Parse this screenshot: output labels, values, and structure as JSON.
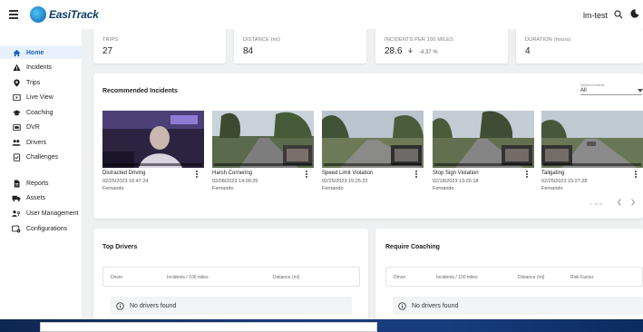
{
  "header": {
    "logo_text": "EasiTrack",
    "username": "lm-test"
  },
  "sidebar": {
    "items": [
      {
        "label": "Home",
        "icon": "home-icon",
        "active": true
      },
      {
        "label": "Incidents",
        "icon": "warning-icon"
      },
      {
        "label": "Trips",
        "icon": "map-pin-icon"
      },
      {
        "label": "Live View",
        "icon": "live-view-icon"
      },
      {
        "label": "Coaching",
        "icon": "graduation-cap-icon"
      },
      {
        "label": "DVR",
        "icon": "dvr-icon"
      },
      {
        "label": "Drivers",
        "icon": "people-icon"
      },
      {
        "label": "Challenges",
        "icon": "challenges-icon"
      },
      {
        "label": "Reports",
        "icon": "document-icon"
      },
      {
        "label": "Assets",
        "icon": "truck-icon"
      },
      {
        "label": "User Management",
        "icon": "user-key-icon"
      },
      {
        "label": "Configurations",
        "icon": "settings-panel-icon"
      }
    ]
  },
  "stats": [
    {
      "label": "TRIPS",
      "value": "27"
    },
    {
      "label": "DISTANCE (mi)",
      "value": "84"
    },
    {
      "label": "INCIDENTS PER 100 MILES",
      "value": "28.6",
      "trend": "-4.37 %"
    },
    {
      "label": "DURATION (hours)",
      "value": "4"
    }
  ],
  "recommended": {
    "title": "Recommended Incidents",
    "select_label": "Select Incident",
    "select_value": "All",
    "pager": "1 - 5 / 5",
    "incidents": [
      {
        "title": "Distracted Driving",
        "time": "02/25/2023 16:47:24",
        "driver": "Fernando"
      },
      {
        "title": "Harsh Cornering",
        "time": "02/08/2023 14:09:25",
        "driver": "Fernando"
      },
      {
        "title": "Speed Limit Violation",
        "time": "02/25/2023 15:25:22",
        "driver": "Fernando"
      },
      {
        "title": "Stop Sign Violation",
        "time": "02/18/2023 13:26:18",
        "driver": "Fernando"
      },
      {
        "title": "Tailgating",
        "time": "02/25/2023 15:27:28",
        "driver": "Fernando"
      }
    ]
  },
  "top_drivers": {
    "title": "Top Drivers",
    "columns": [
      "Driver",
      "Incidents / 100 miles",
      "Distance (mi)"
    ],
    "empty_text": "No drivers found"
  },
  "require_coaching": {
    "title": "Require Coaching",
    "columns": [
      "Driver",
      "Incidents / 100 miles",
      "Distance (mi)",
      "Risk Factor"
    ],
    "empty_text": "No drivers found"
  },
  "colors": {
    "accent": "#1565c0",
    "background": "#eef0f2",
    "trend_down": "#666666"
  }
}
